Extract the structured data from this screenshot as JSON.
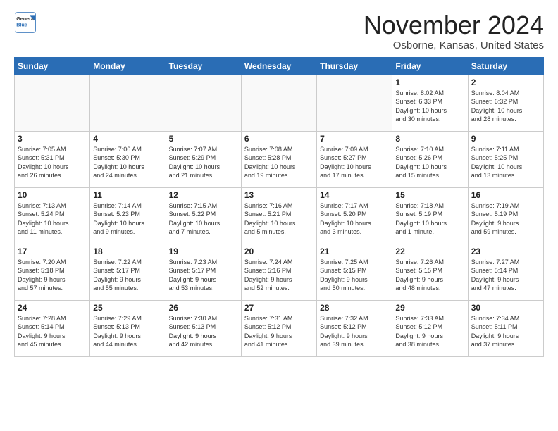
{
  "header": {
    "logo": {
      "general": "General",
      "blue": "Blue"
    },
    "title": "November 2024",
    "location": "Osborne, Kansas, United States"
  },
  "weekdays": [
    "Sunday",
    "Monday",
    "Tuesday",
    "Wednesday",
    "Thursday",
    "Friday",
    "Saturday"
  ],
  "weeks": [
    [
      {
        "day": "",
        "info": ""
      },
      {
        "day": "",
        "info": ""
      },
      {
        "day": "",
        "info": ""
      },
      {
        "day": "",
        "info": ""
      },
      {
        "day": "",
        "info": ""
      },
      {
        "day": "1",
        "info": "Sunrise: 8:02 AM\nSunset: 6:33 PM\nDaylight: 10 hours\nand 30 minutes."
      },
      {
        "day": "2",
        "info": "Sunrise: 8:04 AM\nSunset: 6:32 PM\nDaylight: 10 hours\nand 28 minutes."
      }
    ],
    [
      {
        "day": "3",
        "info": "Sunrise: 7:05 AM\nSunset: 5:31 PM\nDaylight: 10 hours\nand 26 minutes."
      },
      {
        "day": "4",
        "info": "Sunrise: 7:06 AM\nSunset: 5:30 PM\nDaylight: 10 hours\nand 24 minutes."
      },
      {
        "day": "5",
        "info": "Sunrise: 7:07 AM\nSunset: 5:29 PM\nDaylight: 10 hours\nand 21 minutes."
      },
      {
        "day": "6",
        "info": "Sunrise: 7:08 AM\nSunset: 5:28 PM\nDaylight: 10 hours\nand 19 minutes."
      },
      {
        "day": "7",
        "info": "Sunrise: 7:09 AM\nSunset: 5:27 PM\nDaylight: 10 hours\nand 17 minutes."
      },
      {
        "day": "8",
        "info": "Sunrise: 7:10 AM\nSunset: 5:26 PM\nDaylight: 10 hours\nand 15 minutes."
      },
      {
        "day": "9",
        "info": "Sunrise: 7:11 AM\nSunset: 5:25 PM\nDaylight: 10 hours\nand 13 minutes."
      }
    ],
    [
      {
        "day": "10",
        "info": "Sunrise: 7:13 AM\nSunset: 5:24 PM\nDaylight: 10 hours\nand 11 minutes."
      },
      {
        "day": "11",
        "info": "Sunrise: 7:14 AM\nSunset: 5:23 PM\nDaylight: 10 hours\nand 9 minutes."
      },
      {
        "day": "12",
        "info": "Sunrise: 7:15 AM\nSunset: 5:22 PM\nDaylight: 10 hours\nand 7 minutes."
      },
      {
        "day": "13",
        "info": "Sunrise: 7:16 AM\nSunset: 5:21 PM\nDaylight: 10 hours\nand 5 minutes."
      },
      {
        "day": "14",
        "info": "Sunrise: 7:17 AM\nSunset: 5:20 PM\nDaylight: 10 hours\nand 3 minutes."
      },
      {
        "day": "15",
        "info": "Sunrise: 7:18 AM\nSunset: 5:19 PM\nDaylight: 10 hours\nand 1 minute."
      },
      {
        "day": "16",
        "info": "Sunrise: 7:19 AM\nSunset: 5:19 PM\nDaylight: 9 hours\nand 59 minutes."
      }
    ],
    [
      {
        "day": "17",
        "info": "Sunrise: 7:20 AM\nSunset: 5:18 PM\nDaylight: 9 hours\nand 57 minutes."
      },
      {
        "day": "18",
        "info": "Sunrise: 7:22 AM\nSunset: 5:17 PM\nDaylight: 9 hours\nand 55 minutes."
      },
      {
        "day": "19",
        "info": "Sunrise: 7:23 AM\nSunset: 5:17 PM\nDaylight: 9 hours\nand 53 minutes."
      },
      {
        "day": "20",
        "info": "Sunrise: 7:24 AM\nSunset: 5:16 PM\nDaylight: 9 hours\nand 52 minutes."
      },
      {
        "day": "21",
        "info": "Sunrise: 7:25 AM\nSunset: 5:15 PM\nDaylight: 9 hours\nand 50 minutes."
      },
      {
        "day": "22",
        "info": "Sunrise: 7:26 AM\nSunset: 5:15 PM\nDaylight: 9 hours\nand 48 minutes."
      },
      {
        "day": "23",
        "info": "Sunrise: 7:27 AM\nSunset: 5:14 PM\nDaylight: 9 hours\nand 47 minutes."
      }
    ],
    [
      {
        "day": "24",
        "info": "Sunrise: 7:28 AM\nSunset: 5:14 PM\nDaylight: 9 hours\nand 45 minutes."
      },
      {
        "day": "25",
        "info": "Sunrise: 7:29 AM\nSunset: 5:13 PM\nDaylight: 9 hours\nand 44 minutes."
      },
      {
        "day": "26",
        "info": "Sunrise: 7:30 AM\nSunset: 5:13 PM\nDaylight: 9 hours\nand 42 minutes."
      },
      {
        "day": "27",
        "info": "Sunrise: 7:31 AM\nSunset: 5:12 PM\nDaylight: 9 hours\nand 41 minutes."
      },
      {
        "day": "28",
        "info": "Sunrise: 7:32 AM\nSunset: 5:12 PM\nDaylight: 9 hours\nand 39 minutes."
      },
      {
        "day": "29",
        "info": "Sunrise: 7:33 AM\nSunset: 5:12 PM\nDaylight: 9 hours\nand 38 minutes."
      },
      {
        "day": "30",
        "info": "Sunrise: 7:34 AM\nSunset: 5:11 PM\nDaylight: 9 hours\nand 37 minutes."
      }
    ]
  ]
}
